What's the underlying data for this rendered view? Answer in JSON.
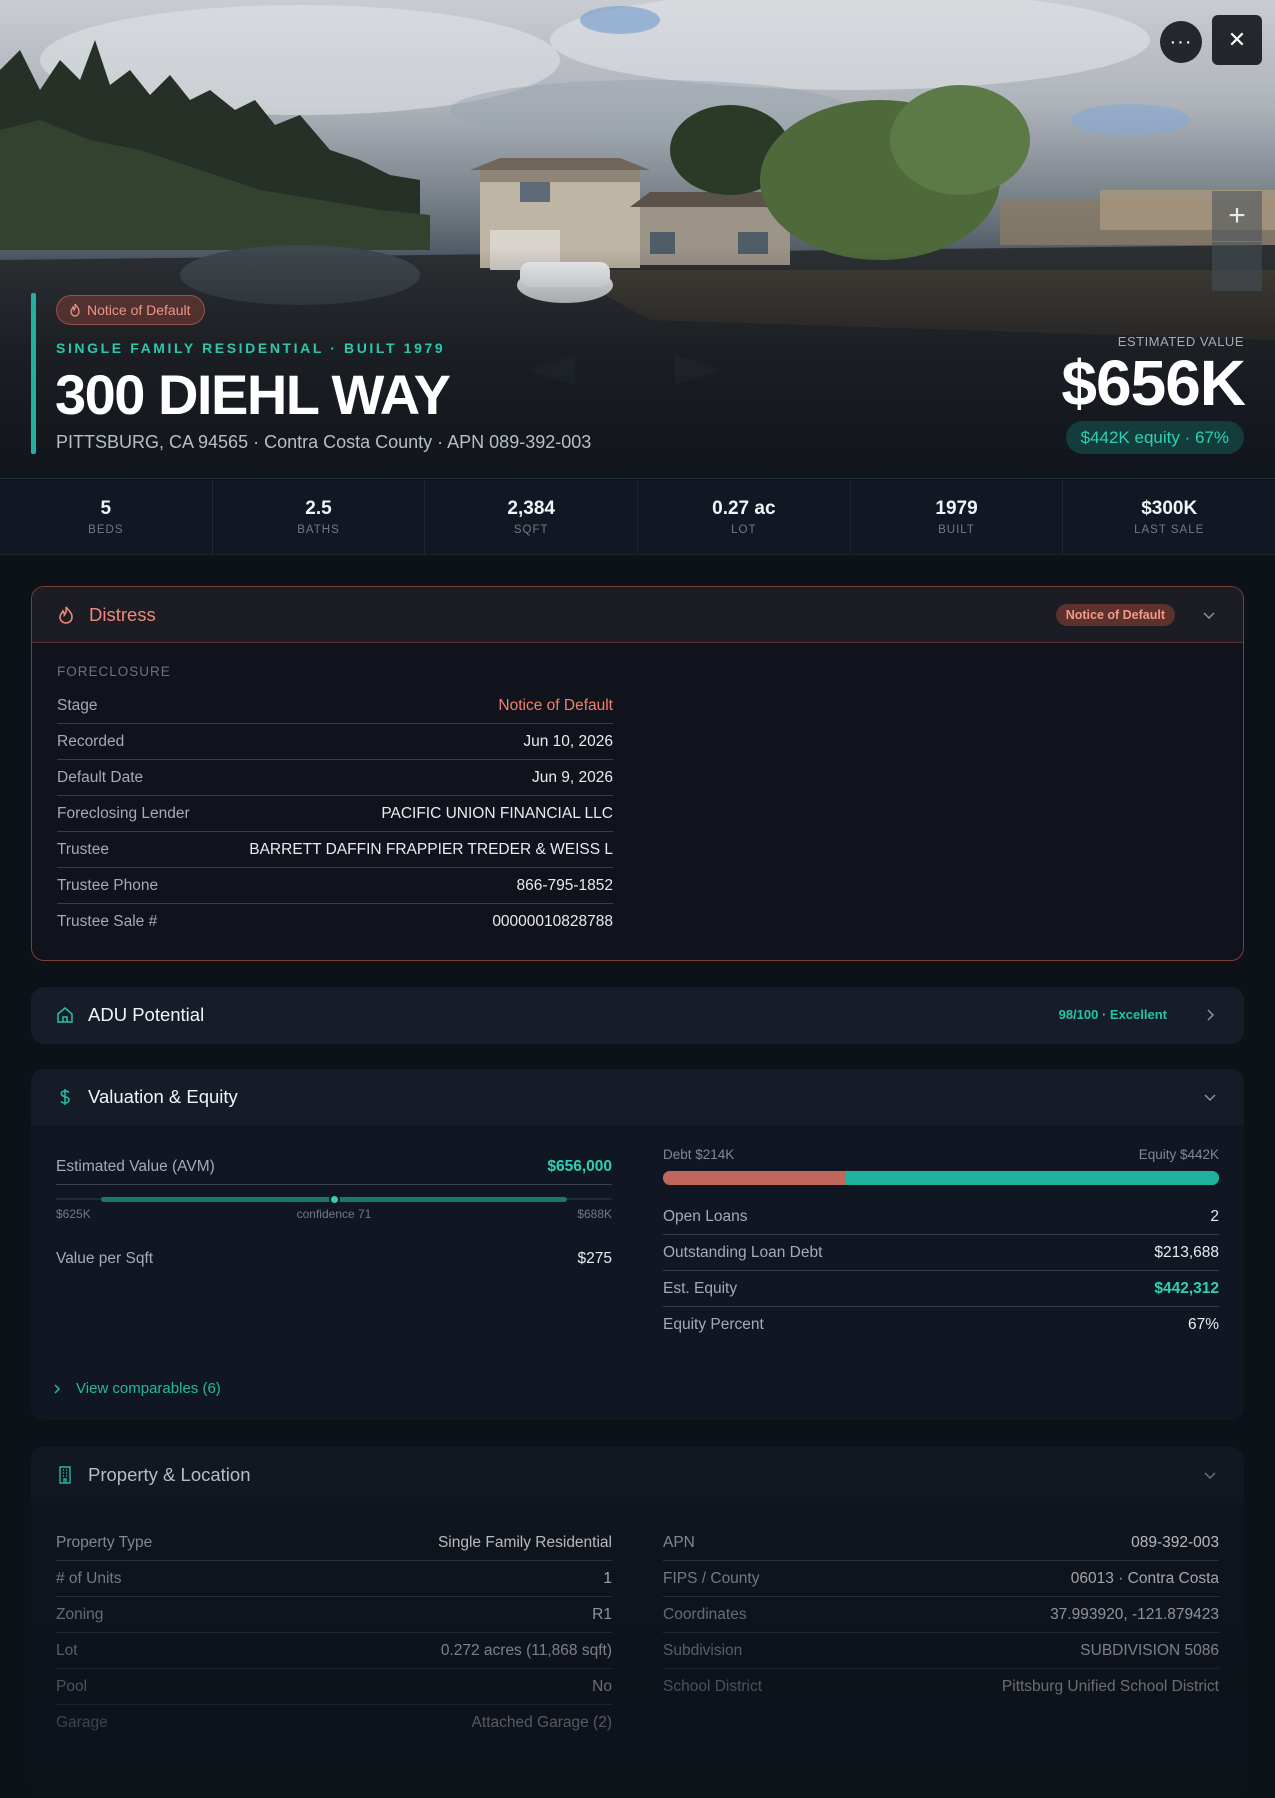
{
  "hero": {
    "badge": "Notice of Default",
    "subhead": "SINGLE FAMILY RESIDENTIAL · BUILT 1979",
    "address": "300 DIEHL WAY",
    "location_line": "PITTSBURG, CA 94565 · Contra Costa County · APN 089-392-003",
    "estimated_label": "ESTIMATED VALUE",
    "estimated_value": "$656K",
    "equity_chip": "$442K equity · 67%",
    "more_label": "···",
    "close_label": "✕",
    "zoom_in_label": "+"
  },
  "stats": [
    {
      "value": "5",
      "label": "BEDS"
    },
    {
      "value": "2.5",
      "label": "BATHS"
    },
    {
      "value": "2,384",
      "label": "SQFT"
    },
    {
      "value": "0.27 ac",
      "label": "LOT"
    },
    {
      "value": "1979",
      "label": "BUILT"
    },
    {
      "value": "$300K",
      "label": "LAST SALE"
    }
  ],
  "distress": {
    "title": "Distress",
    "badge": "Notice of Default",
    "section": "FORECLOSURE",
    "rows": [
      {
        "k": "Stage",
        "v": "Notice of Default"
      },
      {
        "k": "Recorded",
        "v": "Jun 10, 2026"
      },
      {
        "k": "Default Date",
        "v": "Jun 9, 2026"
      },
      {
        "k": "Foreclosing Lender",
        "v": "PACIFIC UNION FINANCIAL LLC"
      },
      {
        "k": "Trustee",
        "v": "BARRETT DAFFIN FRAPPIER TREDER & WEISS L"
      },
      {
        "k": "Trustee Phone",
        "v": "866-795-1852"
      },
      {
        "k": "Trustee Sale #",
        "v": "00000010828788"
      }
    ]
  },
  "adu": {
    "title": "ADU Potential",
    "score": "98/100 · Excellent"
  },
  "valuation": {
    "title": "Valuation & Equity",
    "avm_label": "Estimated Value (AVM)",
    "avm_value": "$656,000",
    "range_low": "$625K",
    "range_high": "$688K",
    "confidence_label": "confidence 71",
    "confidence_position": 0.5,
    "per_sqft_label": "Value per Sqft",
    "per_sqft_value": "$275",
    "debt_label": "Debt $214K",
    "equity_label": "Equity $442K",
    "debt_fraction": 0.33,
    "rows": [
      {
        "k": "Open Loans",
        "v": "2"
      },
      {
        "k": "Outstanding Loan Debt",
        "v": "$213,688"
      },
      {
        "k": "Est. Equity",
        "v": "$442,312"
      },
      {
        "k": "Equity Percent",
        "v": "67%"
      }
    ],
    "comps_link": "View comparables (6)"
  },
  "property": {
    "title": "Property & Location",
    "left": [
      {
        "k": "Property Type",
        "v": "Single Family Residential"
      },
      {
        "k": "# of Units",
        "v": "1"
      },
      {
        "k": "Zoning",
        "v": "R1"
      },
      {
        "k": "Lot",
        "v": "0.272 acres (11,868 sqft)"
      },
      {
        "k": "Pool",
        "v": "No"
      },
      {
        "k": "Garage",
        "v": "Attached Garage (2)"
      }
    ],
    "right": [
      {
        "k": "APN",
        "v": "089-392-003"
      },
      {
        "k": "FIPS / County",
        "v": "06013 · Contra Costa"
      },
      {
        "k": "Coordinates",
        "v": "37.993920, -121.879423"
      },
      {
        "k": "Subdivision",
        "v": "SUBDIVISION 5086"
      },
      {
        "k": "School District",
        "v": "Pittsburg Unified School District"
      }
    ]
  },
  "colors": {
    "accent_teal": "#1fb39e",
    "distress_red": "#f0806b",
    "debt_bar": "#c0665a",
    "equity_bar": "#1fb39e"
  }
}
